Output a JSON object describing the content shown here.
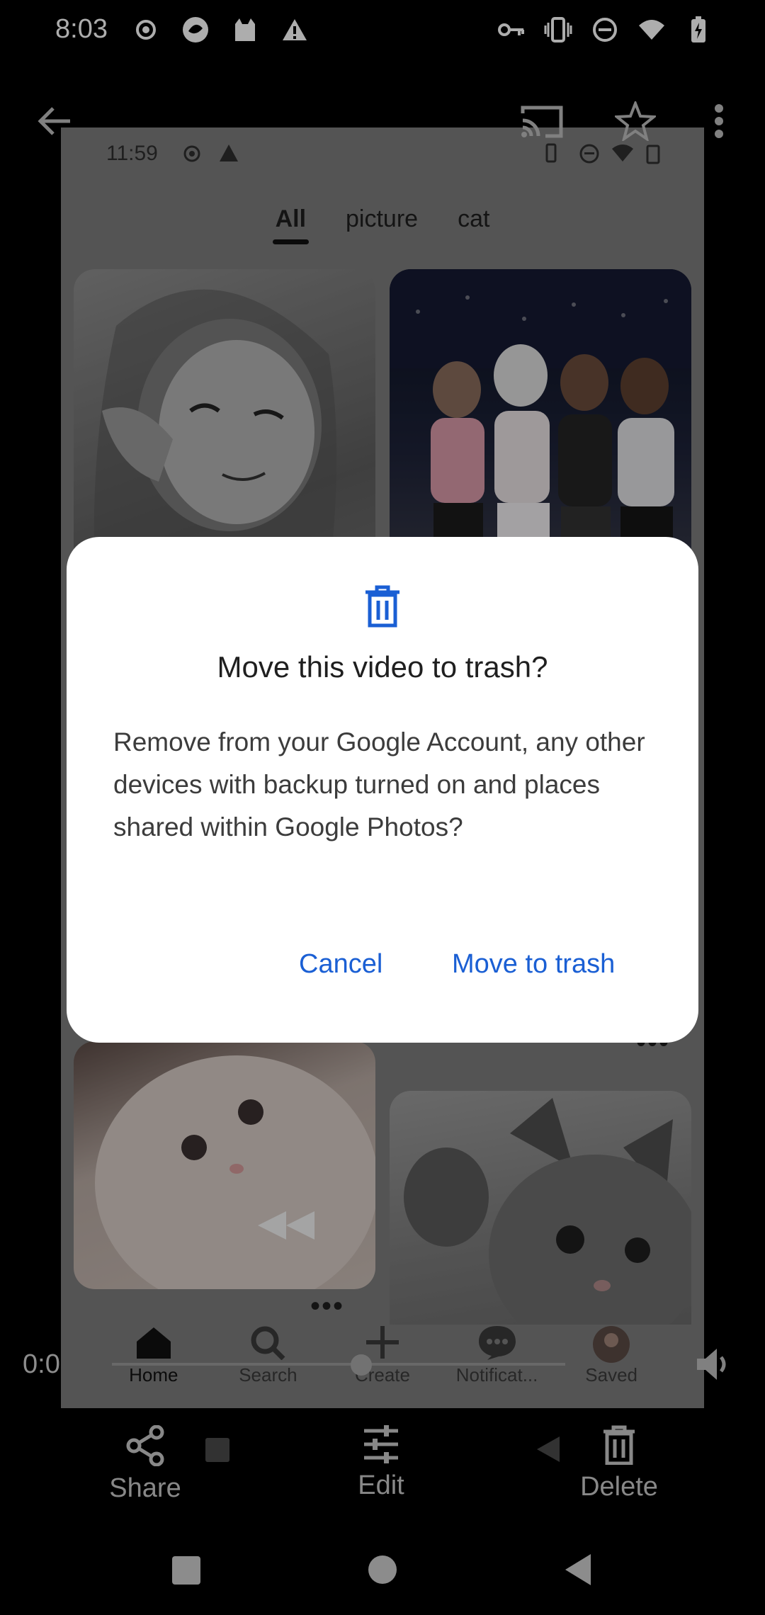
{
  "status_bar": {
    "time": "8:03",
    "left_icons": [
      "record-icon",
      "app-badge-icon",
      "cat-app-icon",
      "warning-icon"
    ],
    "right_icons": [
      "vpn-key-icon",
      "vibrate-icon",
      "dnd-icon",
      "wifi-icon",
      "battery-charging-icon"
    ]
  },
  "top_bar": {
    "back_icon": "arrow-back-icon",
    "cast_icon": "cast-icon",
    "favorite_icon": "star-icon",
    "more_icon": "more-vert-icon"
  },
  "photo": {
    "inner_status_time": "11:59",
    "tabs": [
      {
        "label": "All",
        "active": true
      },
      {
        "label": "picture",
        "active": false
      },
      {
        "label": "cat",
        "active": false
      }
    ],
    "more_dots": "•••",
    "nav": [
      {
        "label": "Home",
        "icon": "home-icon",
        "active": true
      },
      {
        "label": "Search",
        "icon": "search-icon",
        "active": false
      },
      {
        "label": "Create",
        "icon": "plus-icon",
        "active": false
      },
      {
        "label": "Notificat...",
        "icon": "chat-icon",
        "active": false
      },
      {
        "label": "Saved",
        "icon": "avatar-icon",
        "active": false
      }
    ]
  },
  "video": {
    "elapsed": "0:0",
    "progress": 0.55
  },
  "actions": {
    "share": "Share",
    "edit": "Edit",
    "delete": "Delete"
  },
  "dialog": {
    "icon": "trash-icon",
    "title": "Move this video to trash?",
    "body": "Remove from your Google Account, any other devices with backup turned on and places shared within Google Photos?",
    "cancel": "Cancel",
    "confirm": "Move to trash"
  },
  "colors": {
    "accent": "#1a5fd4",
    "dialog_bg": "#ffffff"
  }
}
